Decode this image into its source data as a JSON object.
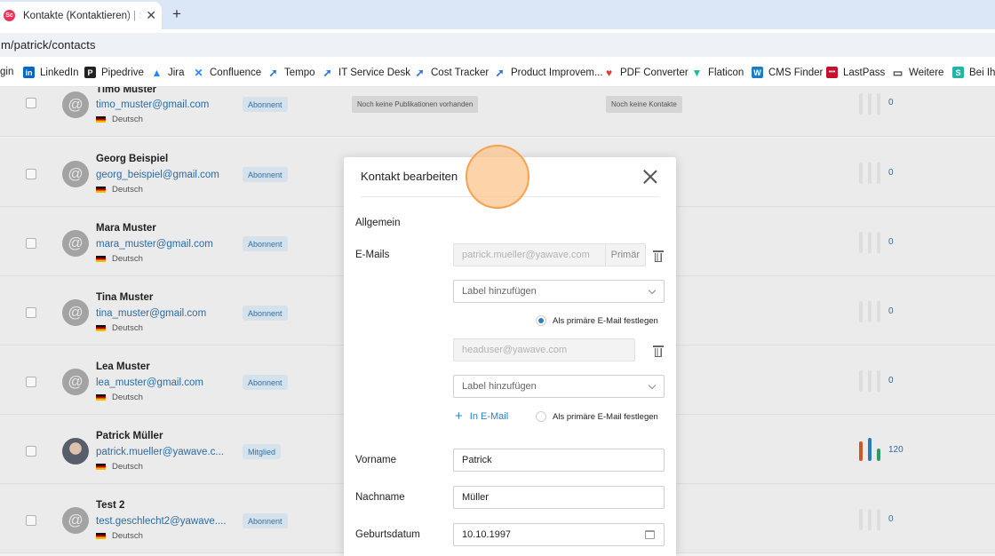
{
  "browser": {
    "tab_title": "Kontakte (Kontaktieren) | Scri",
    "tab_close": "✕",
    "new_tab": "+",
    "url": "m/patrick/contacts",
    "bookmarks": [
      {
        "label": "gin",
        "icon": ""
      },
      {
        "label": "LinkedIn",
        "icon": "linkedin-icon"
      },
      {
        "label": "Pipedrive",
        "icon": "pipedrive-icon"
      },
      {
        "label": "Jira",
        "icon": "jira-icon"
      },
      {
        "label": "Confluence",
        "icon": "confluence-icon"
      },
      {
        "label": "Tempo",
        "icon": "tempo-icon"
      },
      {
        "label": "IT Service Desk",
        "icon": "atlassian-icon"
      },
      {
        "label": "Cost Tracker",
        "icon": "atlassian-icon"
      },
      {
        "label": "Product Improvem...",
        "icon": "atlassian-icon"
      },
      {
        "label": "PDF Converter",
        "icon": "heart-icon"
      },
      {
        "label": "Flaticon",
        "icon": "flaticon-icon"
      },
      {
        "label": "CMS Finder",
        "icon": "wordpress-icon"
      },
      {
        "label": "LastPass",
        "icon": "lastpass-icon"
      },
      {
        "label": "Weitere",
        "icon": "folder-icon"
      },
      {
        "label": "Bei Ihre",
        "icon": "s-icon"
      }
    ],
    "favicon_text": "Sc"
  },
  "contacts": [
    {
      "name": "Timo Muster",
      "email": "timo_muster@gmail.com",
      "language": "Deutsch",
      "status": "Abonnent",
      "publications": "Noch keine Publikationen vorhanden",
      "contacts": "Noch keine Kontakte",
      "count": "0"
    },
    {
      "name": "Georg Beispiel",
      "email": "georg_beispiel@gmail.com",
      "language": "Deutsch",
      "status": "Abonnent",
      "count": "0"
    },
    {
      "name": "Mara Muster",
      "email": "mara_muster@gmail.com",
      "language": "Deutsch",
      "status": "Abonnent",
      "count": "0"
    },
    {
      "name": "Tina Muster",
      "email": "tina_muster@gmail.com",
      "language": "Deutsch",
      "status": "Abonnent",
      "count": "0"
    },
    {
      "name": "Lea Muster",
      "email": "lea_muster@gmail.com",
      "language": "Deutsch",
      "status": "Abonnent",
      "count": "0"
    },
    {
      "name": "Patrick Müller",
      "email": "patrick.mueller@yawave.c...",
      "language": "Deutsch",
      "status": "Mitglied",
      "count": "120"
    },
    {
      "name": "Test 2",
      "email": "test.geschlecht2@yawave....",
      "language": "Deutsch",
      "status": "Abonnent",
      "count": "0"
    }
  ],
  "avatar_glyph": "@",
  "modal": {
    "title": "Kontakt bearbeiten",
    "section_general": "Allgemein",
    "label_emails": "E-Mails",
    "email1": "patrick.mueller@yawave.com",
    "email1_tag": "Primär",
    "label_placeholder": "Label hinzufügen",
    "set_primary": "Als primäre E-Mail festlegen",
    "email2": "headuser@yawave.com",
    "add_email": "In E-Mail",
    "add_plus": "+",
    "label_firstname": "Vorname",
    "firstname": "Patrick",
    "label_lastname": "Nachname",
    "lastname": "Müller",
    "label_birthdate": "Geburtsdatum",
    "birthdate": "10.10.1997"
  },
  "colors": {
    "accent": "#2e7fc0",
    "link": "#2e6fa7",
    "click_indicator": "#f6a24f"
  }
}
